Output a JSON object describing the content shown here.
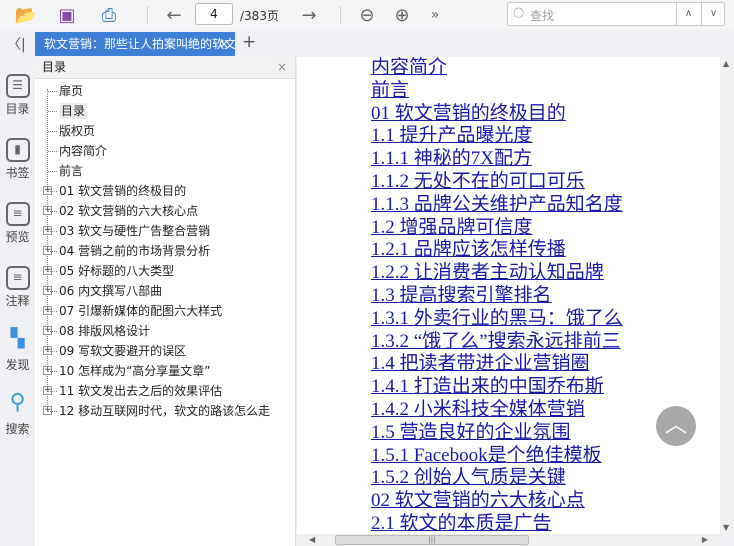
{
  "toolbar": {
    "current_page": "4",
    "total_pages": "/383页",
    "search_placeholder": "查找"
  },
  "tab": {
    "title": "软文营销：那些让人拍案叫绝的软文",
    "close": "×",
    "add": "+"
  },
  "rail": [
    "目录",
    "书签",
    "预览",
    "注释",
    "发现",
    "搜索"
  ],
  "toc": {
    "title": "目录",
    "close": "×",
    "items": [
      {
        "label": "扉页",
        "expandable": false
      },
      {
        "label": "目录",
        "expandable": false,
        "selected": true
      },
      {
        "label": "版权页",
        "expandable": false
      },
      {
        "label": "内容简介",
        "expandable": false
      },
      {
        "label": "前言",
        "expandable": false
      },
      {
        "label": "01 软文营销的终极目的",
        "expandable": true
      },
      {
        "label": "02 软文营销的六大核心点",
        "expandable": true
      },
      {
        "label": "03 软文与硬性广告整合营销",
        "expandable": true
      },
      {
        "label": "04 营销之前的市场背景分析",
        "expandable": true
      },
      {
        "label": "05 好标题的八大类型",
        "expandable": true
      },
      {
        "label": "06 内文撰写八部曲",
        "expandable": true
      },
      {
        "label": "07 引爆新媒体的配图六大样式",
        "expandable": true
      },
      {
        "label": "08 排版风格设计",
        "expandable": true
      },
      {
        "label": "09 写软文要避开的误区",
        "expandable": true
      },
      {
        "label": "10 怎样成为“高分享量文章”",
        "expandable": true
      },
      {
        "label": "11 软文发出去之后的效果评估",
        "expandable": true
      },
      {
        "label": "12 移动互联网时代，软文的路该怎么走",
        "expandable": true
      }
    ]
  },
  "document": {
    "links": [
      "内容简介",
      "前言",
      "01 软文营销的终极目的",
      "1.1 提升产品曝光度",
      "1.1.1 神秘的7X配方",
      "1.1.2 无处不在的可口可乐",
      "1.1.3 品牌公关维护产品知名度",
      "1.2 增强品牌可信度",
      "1.2.1 品牌应该怎样传播",
      "1.2.2 让消费者主动认知品牌",
      "1.3 提高搜索引擎排名",
      "1.3.1 外卖行业的黑马：饿了么",
      "1.3.2 “饿了么”搜索永远排前三",
      "1.4 把读者带进企业营销圈",
      "1.4.1 打造出来的中国乔布斯",
      "1.4.2 小米科技全媒体营销",
      "1.5 营造良好的企业氛围",
      "1.5.1 Facebook是个绝佳模板",
      "1.5.2 创始人气质是关键",
      "02 软文营销的六大核心点",
      "2.1 软文的本质是广告"
    ]
  }
}
